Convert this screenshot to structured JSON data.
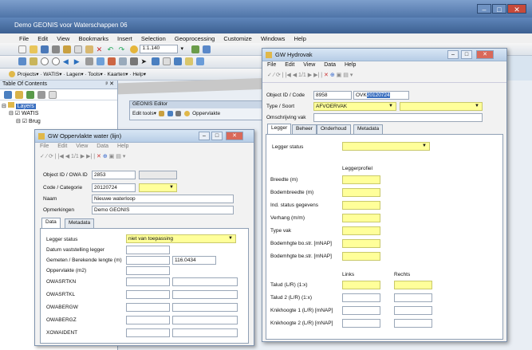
{
  "app": {
    "title": "Demo GEONIS voor Waterschappen 06"
  },
  "main_menu": [
    "File",
    "Edit",
    "View",
    "Bookmarks",
    "Insert",
    "Selection",
    "Geoprocessing",
    "Customize",
    "Windows",
    "Help"
  ],
  "toolbar": {
    "scale": "1:1.140",
    "projects_label": "Projects",
    "watis_label": "WATIS",
    "lagen_label": "Lagen",
    "tools_label": "Tools",
    "kaarten_label": "Kaarten",
    "help_label": "Help"
  },
  "toc": {
    "title": "Table Of Contents",
    "layers": "Layers",
    "watis": "WATIS",
    "brug": "Brug"
  },
  "geonis_editor": {
    "title": "GEONIS Editor",
    "edit_tools": "Edit tools",
    "oppervlakte": "Oppervlakte"
  },
  "dialog1": {
    "title": "GW Oppervlakte water (lijn)",
    "menu": [
      "File",
      "Edit",
      "View",
      "Data",
      "Help"
    ],
    "nav": "1/1",
    "object_id_label": "Object ID / OWA ID",
    "object_id": "2853",
    "code_label": "Code / Categorie",
    "code": "20120724",
    "naam_label": "Naam",
    "naam": "Nieuwe waterloop",
    "opmerkingen_label": "Opmerkingen",
    "opmerkingen": "Demo GEONIS",
    "tabs": [
      "Data",
      "Metadata"
    ],
    "legger_status_label": "Legger status",
    "legger_status": "niet van toepassing",
    "datum_label": "Datum vaststelling legger",
    "gemeten_label": "Gemeten / Berekende lengte (m)",
    "gemeten": "116.0434",
    "oppervlakte_label": "Oppervlakte (m2)",
    "fields": [
      "OWASRTKN",
      "OWASRTKL",
      "OWABERGW",
      "OWABERGZ",
      "XOWAIDENT"
    ]
  },
  "dialog2": {
    "title": "GW Hydrovak",
    "menu": [
      "File",
      "Edit",
      "View",
      "Data",
      "Help"
    ],
    "nav": "1/1",
    "object_id_label": "Object ID / Code",
    "object_id": "8958",
    "ovk_prefix": "OVK",
    "ovk_selected": "20120724",
    "type_label": "Type / Soort",
    "type": "AFVOERVAK",
    "omschrijving_label": "Omschrijving vak",
    "tabs": [
      "Legger",
      "Beheer",
      "Onderhoud",
      "Metadata"
    ],
    "legger_status_label": "Legger status",
    "leggerprofiel": "Leggerprofiel",
    "profiel_labels": [
      "Breedte (m)",
      "Bodembreedte (m)",
      "Ind. status gegevens",
      "Verhang (m/m)",
      "Type vak",
      "Bodemhgte bo.str. [mNAP]",
      "Bodemhgte be.str. [mNAP]"
    ],
    "links": "Links",
    "rechts": "Rechts",
    "talud_labels": [
      "Talud (L/R) (1:x)",
      "Talud 2 (L/R) (1:x)",
      "Knikhoogte 1 (L/R) [mNAP]",
      "Knikhoogte 2 (L/R) [mNAP]"
    ]
  }
}
